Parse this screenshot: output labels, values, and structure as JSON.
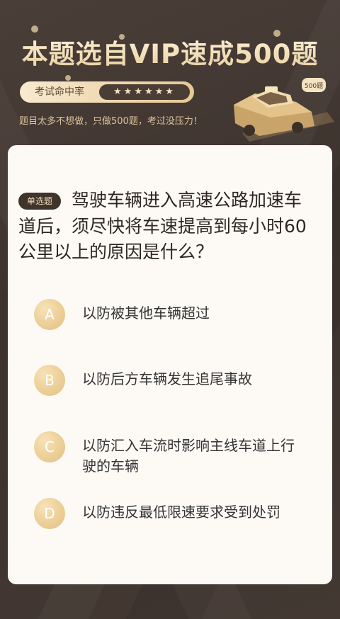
{
  "banner": {
    "headline": "本题选自VIP速成500题",
    "rate_label": "考试命中率",
    "rate_stars": "★★★★★★",
    "subtitle": "题目太多不想做，只做500题，考过没压力！",
    "taxi_sign": "500题"
  },
  "question": {
    "type_badge": "单选题",
    "text": "驾驶车辆进入高速公路加速车道后，须尽快将车速提高到每小时60公里以上的原因是什么？"
  },
  "options": [
    {
      "letter": "A",
      "text": "以防被其他车辆超过"
    },
    {
      "letter": "B",
      "text": "以防后方车辆发生追尾事故"
    },
    {
      "letter": "C",
      "text": "以防汇入车流时影响主线车道上行驶的车辆"
    },
    {
      "letter": "D",
      "text": "以防违反最低限速要求受到处罚"
    }
  ],
  "colors": {
    "background": "#433832",
    "accent_gold": "#e3bf80",
    "card": "#fdfaf6"
  }
}
